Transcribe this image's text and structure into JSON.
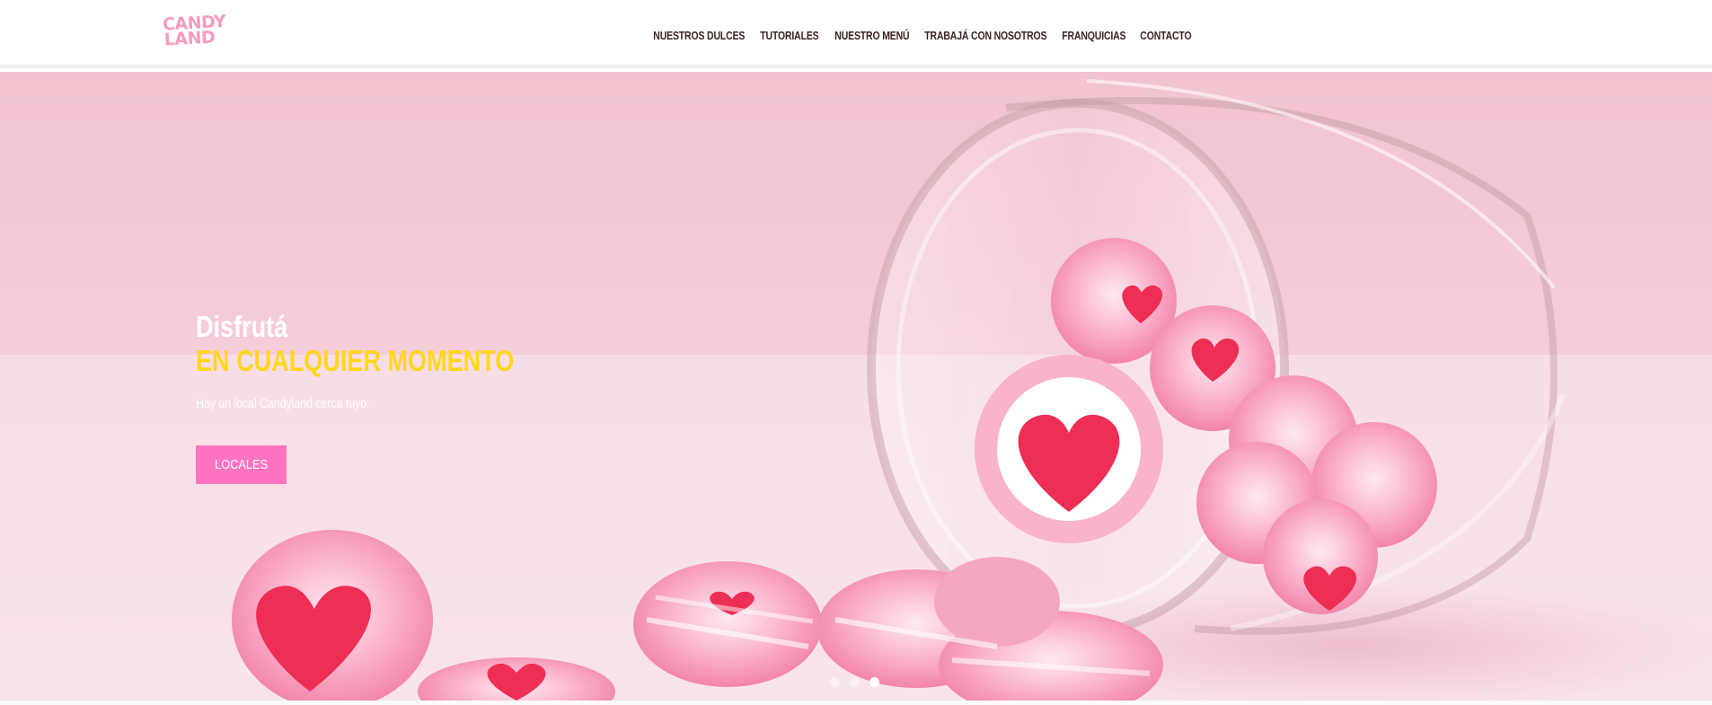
{
  "header": {
    "logo": {
      "line1": "CANDY",
      "line2": "LAND"
    },
    "nav": [
      {
        "label": "NUESTROS DULCES"
      },
      {
        "label": "TUTORIALES"
      },
      {
        "label": "NUESTRO MENÚ"
      },
      {
        "label": "TRABAJÁ CON NOSOTROS"
      },
      {
        "label": "FRANQUICIAS"
      },
      {
        "label": "CONTACTO"
      }
    ]
  },
  "hero": {
    "title": "Disfrutá",
    "subtitle": "EN CUALQUIER MOMENTO",
    "copy": "Hay un local Candyland cerca tuyo.",
    "cta_label": "LOCALES",
    "slides_total": 3,
    "slide_active": 3
  },
  "colors": {
    "brand_pink": "#ff73c0",
    "logo_pink": "#f49cbf",
    "accent_yellow": "#ffd71a",
    "nav_text": "#3c2424"
  }
}
